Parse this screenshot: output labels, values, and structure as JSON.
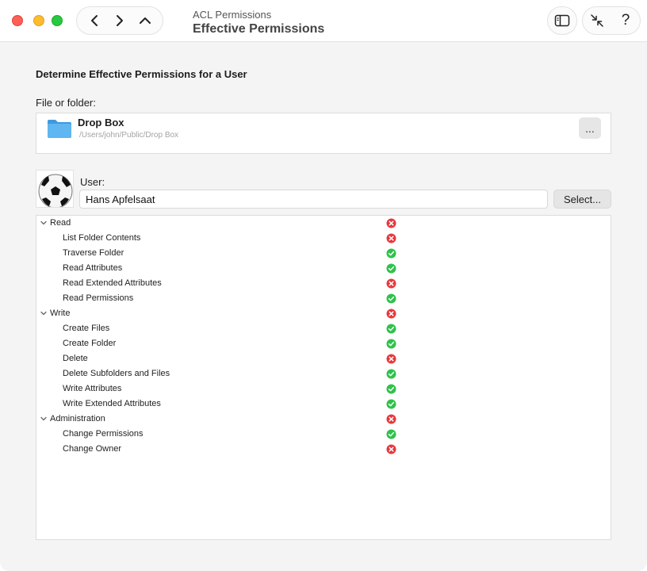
{
  "window": {
    "title_sub": "ACL Permissions",
    "title_main": "Effective Permissions"
  },
  "main": {
    "section_title": "Determine Effective Permissions for a User",
    "file_label": "File or folder:",
    "file": {
      "name": "Drop Box",
      "path": "/Users/john/Public/Drop Box",
      "more_label": "..."
    },
    "user_label": "User:",
    "user_value": "Hans Apfelsaat",
    "select_label": "Select..."
  },
  "permissions": [
    {
      "label": "Read",
      "type": "group",
      "status": "deny"
    },
    {
      "label": "List Folder Contents",
      "type": "child",
      "status": "deny"
    },
    {
      "label": "Traverse Folder",
      "type": "child",
      "status": "allow"
    },
    {
      "label": "Read Attributes",
      "type": "child",
      "status": "allow"
    },
    {
      "label": "Read Extended Attributes",
      "type": "child",
      "status": "deny"
    },
    {
      "label": "Read Permissions",
      "type": "child",
      "status": "allow"
    },
    {
      "label": "Write",
      "type": "group",
      "status": "deny"
    },
    {
      "label": "Create Files",
      "type": "child",
      "status": "allow"
    },
    {
      "label": "Create Folder",
      "type": "child",
      "status": "allow"
    },
    {
      "label": "Delete",
      "type": "child",
      "status": "deny"
    },
    {
      "label": "Delete Subfolders and Files",
      "type": "child",
      "status": "allow"
    },
    {
      "label": "Write Attributes",
      "type": "child",
      "status": "allow"
    },
    {
      "label": "Write Extended Attributes",
      "type": "child",
      "status": "allow"
    },
    {
      "label": "Administration",
      "type": "group",
      "status": "deny"
    },
    {
      "label": "Change Permissions",
      "type": "child",
      "status": "allow"
    },
    {
      "label": "Change Owner",
      "type": "child",
      "status": "deny"
    }
  ],
  "colors": {
    "allow": "#2ec24a",
    "deny": "#e8383d",
    "folder": "#4aa8e8"
  }
}
